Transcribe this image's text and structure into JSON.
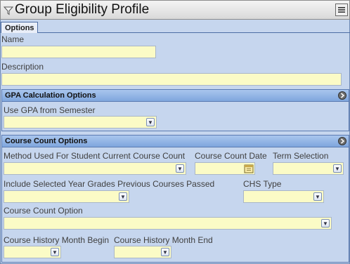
{
  "window": {
    "title": "Group Eligibility Profile",
    "funnel_icon": "filter-icon",
    "menu_icon": "menu-icon"
  },
  "tabs": [
    {
      "label": "Options"
    }
  ],
  "form": {
    "name_label": "Name",
    "name_value": "",
    "description_label": "Description",
    "description_value": ""
  },
  "gpa_section": {
    "title": "GPA Calculation Options",
    "use_gpa_label": "Use GPA from Semester",
    "use_gpa_value": ""
  },
  "course_section": {
    "title": "Course Count Options",
    "method_label": "Method Used For Student Current Course Count",
    "method_value": "",
    "count_date_label": "Course Count Date",
    "count_date_value": "",
    "term_selection_label": "Term Selection",
    "term_selection_value": "",
    "include_grades_label": "Include Selected Year Grades Previous Courses Passed",
    "include_grades_value": "",
    "chs_type_label": "CHS Type",
    "chs_type_value": "",
    "count_option_label": "Course Count Option",
    "count_option_value": "",
    "month_begin_label": "Course History Month Begin",
    "month_begin_value": "",
    "month_end_label": "Course History Month End",
    "month_end_value": ""
  },
  "colors": {
    "field_bg": "#fbfbc6",
    "panel_bg": "#c6d6ee",
    "section_header": "#8fb2e4"
  }
}
